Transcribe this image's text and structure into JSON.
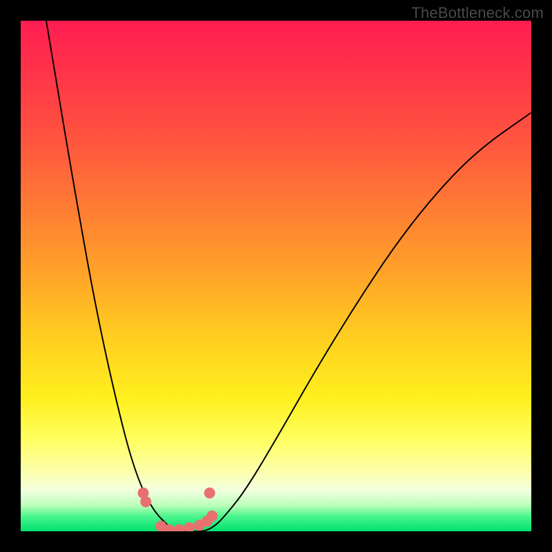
{
  "watermark": "TheBottleneck.com",
  "chart_data": {
    "type": "line",
    "title": "",
    "xlabel": "",
    "ylabel": "",
    "xlim": [
      0,
      100
    ],
    "ylim": [
      0,
      100
    ],
    "legend": false,
    "grid": false,
    "series": [
      {
        "name": "curve",
        "x": [
          5,
          10,
          15,
          20,
          23,
          26,
          29,
          30,
          32,
          34,
          36,
          38,
          40,
          44,
          50,
          58,
          66,
          74,
          82,
          90,
          100
        ],
        "values": [
          100,
          70,
          42,
          20,
          10,
          4,
          1,
          0,
          0,
          0,
          0,
          1,
          3,
          8,
          18,
          32,
          45,
          57,
          67,
          75,
          82
        ]
      }
    ],
    "markers": [
      {
        "x": 24.0,
        "y": 7.5
      },
      {
        "x": 24.5,
        "y": 5.8
      },
      {
        "x": 27.5,
        "y": 1.0
      },
      {
        "x": 29.0,
        "y": 0.3
      },
      {
        "x": 31.0,
        "y": 0.3
      },
      {
        "x": 33.0,
        "y": 0.7
      },
      {
        "x": 35.0,
        "y": 1.2
      },
      {
        "x": 36.5,
        "y": 2.0
      },
      {
        "x": 37.5,
        "y": 3.0
      },
      {
        "x": 37.0,
        "y": 7.5
      }
    ],
    "background_gradient": {
      "direction": "vertical",
      "stops": [
        {
          "pos": 0.0,
          "color": "#ff1d52"
        },
        {
          "pos": 0.5,
          "color": "#ffa528"
        },
        {
          "pos": 0.78,
          "color": "#fff01e"
        },
        {
          "pos": 0.92,
          "color": "#f2ffe0"
        },
        {
          "pos": 1.0,
          "color": "#00e170"
        }
      ]
    }
  }
}
